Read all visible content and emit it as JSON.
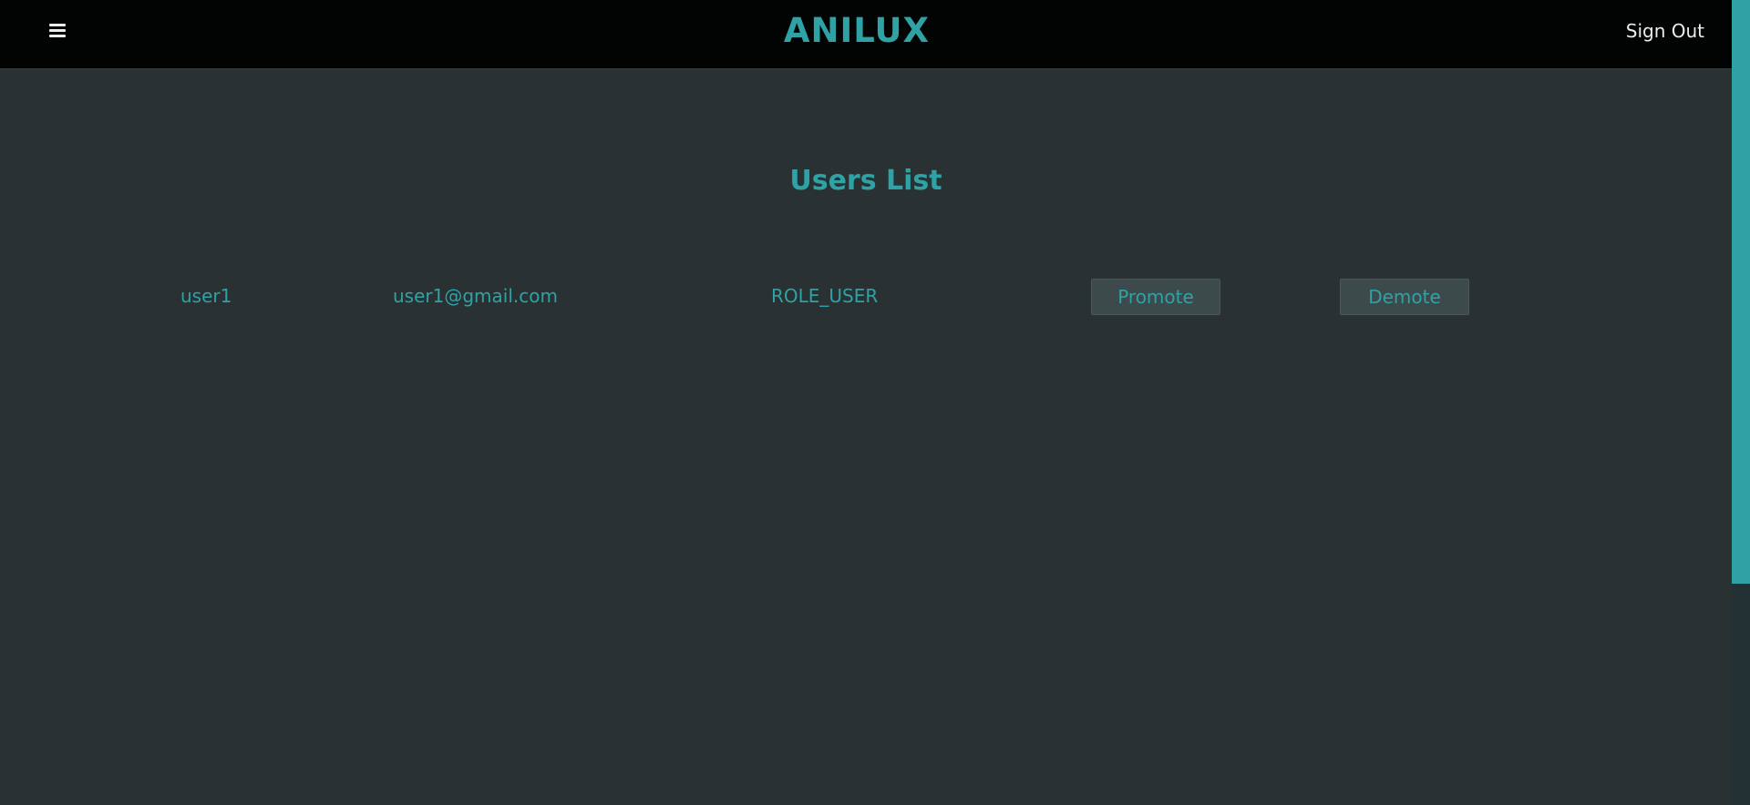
{
  "header": {
    "brand": "ANILUX",
    "menu_icon": "hamburger-menu-icon",
    "sign_out_label": "Sign Out"
  },
  "main": {
    "title": "Users List",
    "users": [
      {
        "username": "user1",
        "email": "user1@gmail.com",
        "role": "ROLE_USER",
        "promote_label": "Promote",
        "demote_label": "Demote"
      }
    ]
  },
  "colors": {
    "accent": "#2fa2a5",
    "navbar_bg": "#020404",
    "page_bg": "#293133",
    "button_bg": "#3d4a4c",
    "nav_text": "#e8eeee"
  }
}
